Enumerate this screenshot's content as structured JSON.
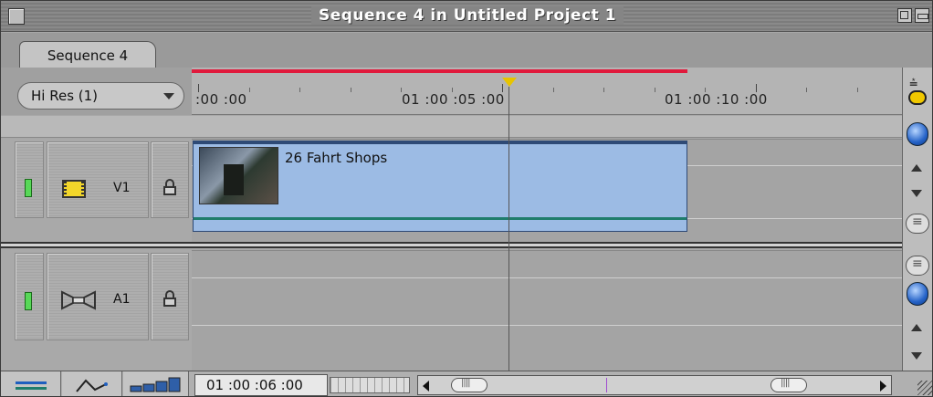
{
  "window": {
    "title": "Sequence 4 in Untitled Project 1"
  },
  "tabs": [
    {
      "label": "Sequence 4"
    }
  ],
  "ruler": {
    "resolution_menu": "Hi Res  (1)",
    "timecodes": [
      ":00 :00",
      "01 :00 :05 :00",
      "01 :00 :10 :00"
    ]
  },
  "tracks": [
    {
      "label": "V1",
      "type": "video",
      "icon": "film-icon"
    },
    {
      "label": "A1",
      "type": "audio",
      "icon": "speaker-icon"
    }
  ],
  "clip": {
    "name": "26 Fahrt Shops"
  },
  "bottom": {
    "current_timecode": "01 :00 :06 :00"
  },
  "colors": {
    "render_bar": "#e01a3c",
    "playhead": "#e7c400",
    "clip": "#9cbbe4",
    "track_enable": "#58d858"
  }
}
